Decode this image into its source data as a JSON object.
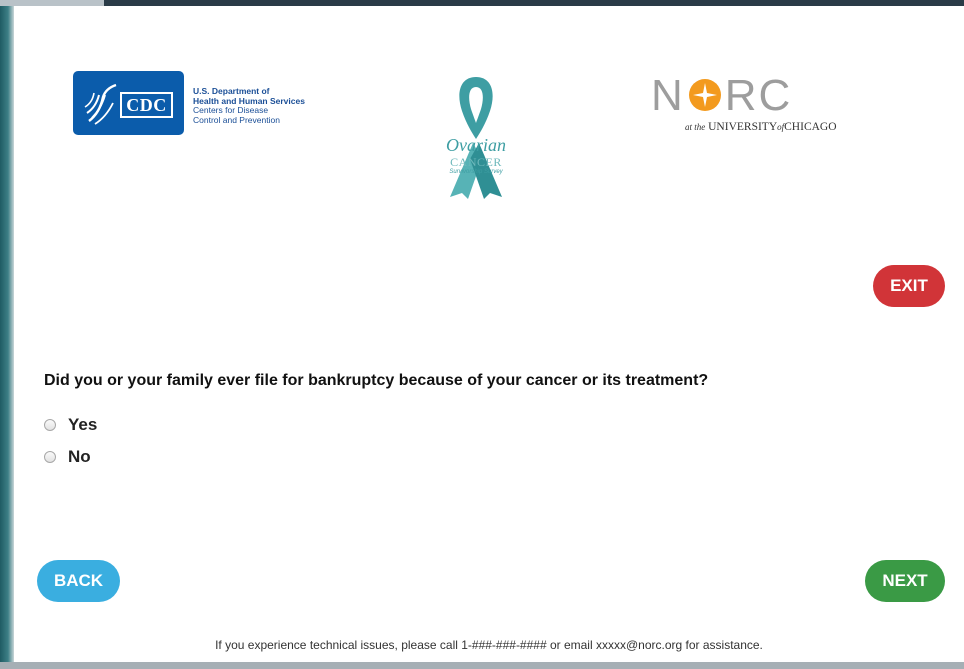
{
  "header": {
    "cdc_logo": {
      "mark": "CDC",
      "agency_lines": [
        "U.S. Department of",
        "Health and Human Services",
        "Centers for Disease",
        "Control and Prevention"
      ]
    },
    "survey_logo": {
      "title": "Ovarian",
      "subtitle": "CANCER",
      "tagline": "Survivorship Survey",
      "icon": "awareness-ribbon-icon",
      "color": "#3e9ea3"
    },
    "norc_logo": {
      "left": "N",
      "right": "RC",
      "prefix": "at the",
      "university": "UNIVERSITY",
      "of": "of",
      "city": "CHICAGO",
      "accent": "#f39a1e"
    }
  },
  "buttons": {
    "exit": "EXIT",
    "back": "BACK",
    "next": "NEXT"
  },
  "colors": {
    "exit": "#d13438",
    "back": "#3aaee0",
    "next": "#3a9a45",
    "cdc_blue": "#0b5cab"
  },
  "question": {
    "text": "Did you or your family ever file for bankruptcy because of your cancer or its treatment?",
    "options": [
      {
        "label": "Yes",
        "selected": false
      },
      {
        "label": "No",
        "selected": false
      }
    ]
  },
  "footer": {
    "text": "If you experience technical issues, please call 1-###-###-#### or email xxxxx@norc.org for assistance."
  }
}
